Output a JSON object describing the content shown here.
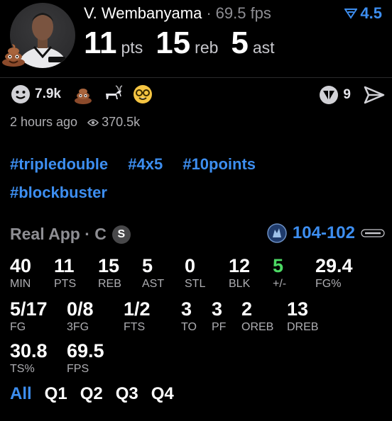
{
  "header": {
    "player_name": "V. Wembanyama",
    "separator": "·",
    "fps": "69.5 fps",
    "rating": "4.5",
    "statline": [
      {
        "value": "11",
        "unit": "pts"
      },
      {
        "value": "15",
        "unit": "reb"
      },
      {
        "value": "5",
        "unit": "ast"
      }
    ]
  },
  "reactions": {
    "smile_count": "7.9k",
    "share_count": "9"
  },
  "meta": {
    "time_ago": "2 hours ago",
    "views": "370.5k"
  },
  "tags": [
    "#tripledouble",
    "#4x5",
    "#10points",
    "#blockbuster"
  ],
  "game": {
    "app_label": "Real App · C",
    "position_badge": "S",
    "score": "104-102"
  },
  "stats": {
    "row1": [
      {
        "value": "40",
        "label": "MIN"
      },
      {
        "value": "11",
        "label": "PTS"
      },
      {
        "value": "15",
        "label": "REB"
      },
      {
        "value": "5",
        "label": "AST"
      },
      {
        "value": "0",
        "label": "STL"
      },
      {
        "value": "12",
        "label": "BLK"
      },
      {
        "value": "5",
        "label": "+/-"
      },
      {
        "value": "29.4",
        "label": "FG%"
      }
    ],
    "row2": [
      {
        "value": "5/17",
        "label": "FG"
      },
      {
        "value": "0/8",
        "label": "3FG"
      },
      {
        "value": "1/2",
        "label": "FTS"
      },
      {
        "value": "3",
        "label": "TO"
      },
      {
        "value": "3",
        "label": "PF"
      },
      {
        "value": "2",
        "label": "OREB"
      },
      {
        "value": "13",
        "label": "DREB"
      }
    ],
    "row3": [
      {
        "value": "30.8",
        "label": "TS%"
      },
      {
        "value": "69.5",
        "label": "FPS"
      }
    ]
  },
  "periods": [
    "All",
    "Q1",
    "Q2",
    "Q3",
    "Q4"
  ],
  "colors": {
    "accent": "#3d8ef0",
    "positive": "#4cd964",
    "background": "#000000"
  }
}
